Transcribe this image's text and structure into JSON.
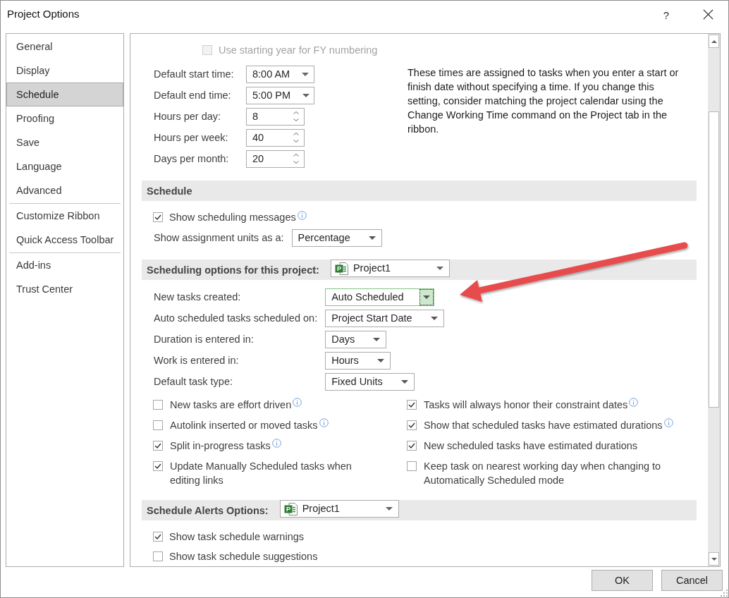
{
  "window": {
    "title": "Project Options",
    "help": "?"
  },
  "sidebar": {
    "groups": [
      {
        "items": [
          {
            "label": "General",
            "selected": false
          },
          {
            "label": "Display",
            "selected": false
          },
          {
            "label": "Schedule",
            "selected": true
          },
          {
            "label": "Proofing",
            "selected": false
          },
          {
            "label": "Save",
            "selected": false
          },
          {
            "label": "Language",
            "selected": false
          },
          {
            "label": "Advanced",
            "selected": false
          }
        ]
      },
      {
        "items": [
          {
            "label": "Customize Ribbon",
            "selected": false
          },
          {
            "label": "Quick Access Toolbar",
            "selected": false
          }
        ]
      },
      {
        "items": [
          {
            "label": "Add-ins",
            "selected": false
          },
          {
            "label": "Trust Center",
            "selected": false
          }
        ]
      }
    ]
  },
  "calendar": {
    "year_option": {
      "label": "Use starting year for FY numbering",
      "checked": false,
      "disabled": true
    },
    "fields": [
      {
        "kind": "dropdown",
        "label": "Default start time:",
        "value": "8:00 AM"
      },
      {
        "kind": "dropdown",
        "label": "Default end time:",
        "value": "5:00 PM"
      },
      {
        "kind": "spinner",
        "label": "Hours per day:",
        "value": "8"
      },
      {
        "kind": "spinner",
        "label": "Hours per week:",
        "value": "40"
      },
      {
        "kind": "spinner",
        "label": "Days per month:",
        "value": "20"
      }
    ],
    "note": "These times are assigned to tasks when you enter a start or finish date without specifying a time. If you change this setting, consider matching the project calendar using the Change Working Time command on the Project tab in the ribbon."
  },
  "sections": [
    {
      "title": "Schedule",
      "rows": [
        {
          "kind": "checkbox",
          "label": "Show scheduling messages",
          "checked": true,
          "info": true
        },
        {
          "kind": "dropdown",
          "label": "Show assignment units as a:",
          "value": "Percentage",
          "focused": false
        }
      ]
    },
    {
      "title": "Scheduling options for this project:",
      "project": {
        "name": "Project1",
        "icon_letter": "P"
      },
      "rows": [
        {
          "kind": "dropdown",
          "label": "New tasks created:",
          "value": "Auto Scheduled",
          "focused": true
        },
        {
          "kind": "dropdown",
          "label": "Auto scheduled tasks scheduled on:",
          "value": "Project Start Date",
          "focused": false
        },
        {
          "kind": "dropdown",
          "label": "Duration is entered in:",
          "value": "Days",
          "focused": false
        },
        {
          "kind": "dropdown",
          "label": "Work is entered in:",
          "value": "Hours",
          "focused": false
        },
        {
          "kind": "dropdown",
          "label": "Default task type:",
          "value": "Fixed Units",
          "focused": false
        },
        {
          "kind": "checkbox_grid",
          "columns": [
            {
              "items": [
                {
                  "label": "New tasks are effort driven",
                  "checked": false,
                  "info": true
                },
                {
                  "label": "Autolink inserted or moved tasks",
                  "checked": false,
                  "info": true
                },
                {
                  "label": "Split in-progress tasks",
                  "checked": true,
                  "info": true
                },
                {
                  "label": "Update Manually Scheduled tasks when editing links",
                  "checked": true,
                  "info": false
                }
              ]
            },
            {
              "items": [
                {
                  "label": "Tasks will always honor their constraint dates",
                  "checked": true,
                  "info": true
                },
                {
                  "label": "Show that scheduled tasks have estimated durations",
                  "checked": true,
                  "info": true
                },
                {
                  "label": "New scheduled tasks have estimated durations",
                  "checked": true,
                  "info": false
                },
                {
                  "label": "Keep task on nearest working day when changing to Automatically Scheduled mode",
                  "checked": false,
                  "info": false
                }
              ]
            }
          ]
        }
      ]
    },
    {
      "title": "Schedule Alerts Options:",
      "project": {
        "name": "Project1",
        "icon_letter": "P"
      },
      "rows": [
        {
          "kind": "checkbox",
          "label": "Show task schedule warnings",
          "checked": true,
          "info": false
        },
        {
          "kind": "checkbox",
          "label": "Show task schedule suggestions",
          "checked": false,
          "info": false
        }
      ]
    }
  ],
  "buttons": [
    {
      "label": "OK"
    },
    {
      "label": "Cancel"
    }
  ]
}
